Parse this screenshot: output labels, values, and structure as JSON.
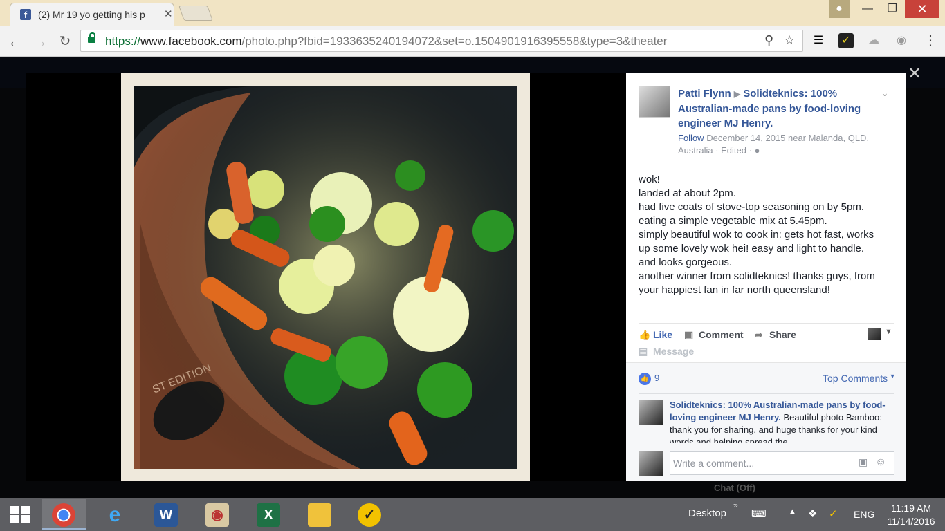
{
  "browser": {
    "tab_title": "(2) Mr 19 yo getting his p",
    "url_scheme": "https://",
    "url_domain": "www.facebook.com",
    "url_path": "/photo.php?fbid=1933635240194072&set=o.1504901916395558&type=3&theater"
  },
  "post": {
    "author": "Patti Flynn",
    "page_name": "Solidteknics: 100% Australian-made pans by food-loving engineer MJ Henry.",
    "follow_label": "Follow",
    "meta": "December 14, 2015 near Malanda, QLD, Australia · Edited ·",
    "body_lines": [
      "wok!",
      "landed at about 2pm.",
      "had five coats of stove-top seasoning on by 5pm.",
      "eating a simple vegetable mix at 5.45pm.",
      "simply beautiful wok to cook in: gets hot fast, works",
      "up some lovely wok hei! easy and light to handle.",
      "and looks gorgeous.",
      "another winner from solidteknics! thanks guys, from",
      "your happiest fan in far north queensland!"
    ]
  },
  "actions": {
    "like": "Like",
    "comment": "Comment",
    "share": "Share",
    "message": "Message"
  },
  "reactions": {
    "count": "9",
    "sort_label": "Top Comments"
  },
  "comment": {
    "author": "Solidteknics: 100% Australian-made pans by food-loving engineer MJ Henry.",
    "text": " Beautiful photo Bamboo: thank you for sharing, and huge thanks for your kind words and helping spread the"
  },
  "composer": {
    "placeholder": "Write a comment..."
  },
  "chat_status": "Chat (Off)",
  "taskbar": {
    "desktop_label": "Desktop",
    "language": "ENG",
    "time": "11:19 AM",
    "date": "11/14/2016"
  },
  "colors": {
    "facebook_blue": "#365899",
    "link_blue": "#4267b2",
    "taskbar": "#5d5e62"
  }
}
